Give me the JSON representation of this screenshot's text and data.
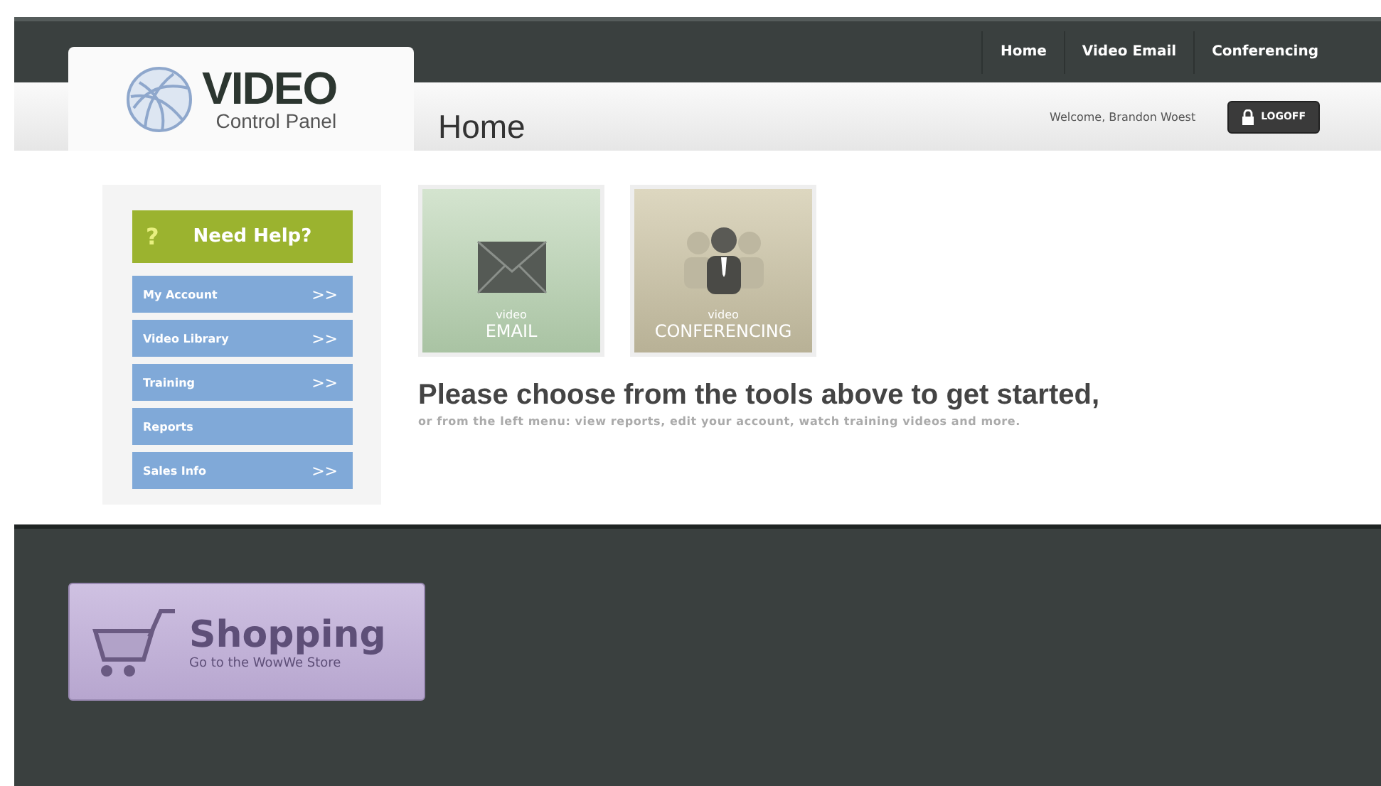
{
  "logo": {
    "title": "VIDEO",
    "subtitle": "Control Panel"
  },
  "top_nav": [
    {
      "label": "Home"
    },
    {
      "label": "Video Email"
    },
    {
      "label": "Conferencing"
    }
  ],
  "page_title": "Home",
  "welcome": "Welcome, Brandon Woest",
  "logoff": "LOGOFF",
  "help": {
    "icon": "?",
    "label": "Need Help?"
  },
  "menu": [
    {
      "label": "My Account",
      "arrow": ">>"
    },
    {
      "label": "Video Library",
      "arrow": ">>"
    },
    {
      "label": "Training",
      "arrow": ">>"
    },
    {
      "label": "Reports"
    },
    {
      "label": "Sales Info",
      "arrow": ">>"
    }
  ],
  "tiles": [
    {
      "kind": "email",
      "small": "video",
      "big": "EMAIL"
    },
    {
      "kind": "conferencing",
      "small": "video",
      "big": "CONFERENCING"
    }
  ],
  "heading": "Please choose from the tools above to get started,",
  "subheading": "or from the left menu: view reports, edit your account, watch training videos and more.",
  "shopping": {
    "title": "Shopping",
    "subtitle": "Go to the WowWe Store"
  }
}
